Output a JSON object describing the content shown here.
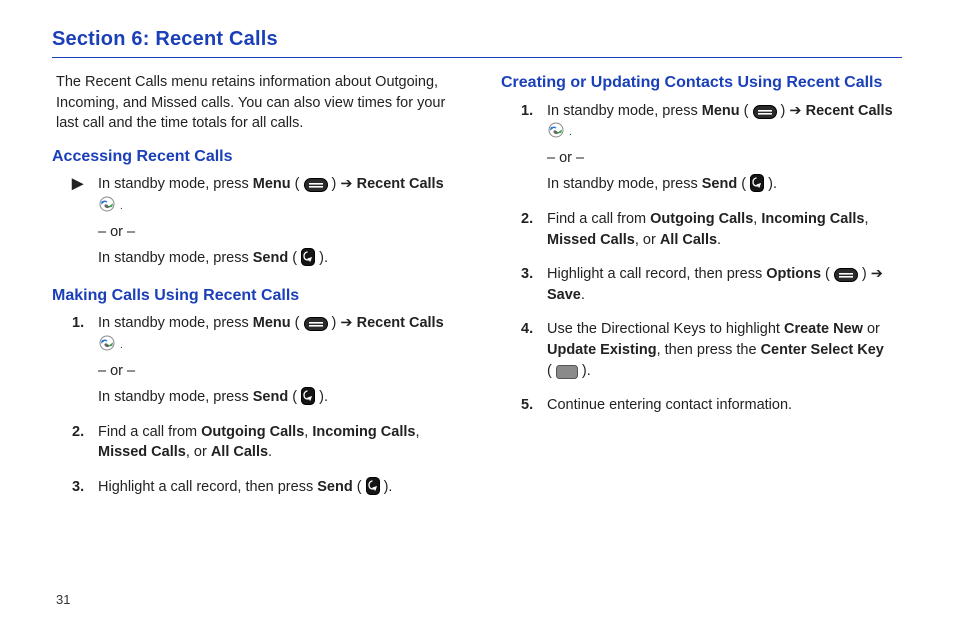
{
  "section_title": "Section 6: Recent Calls",
  "page_number": "31",
  "intro": "The Recent Calls menu retains information about Outgoing, Incoming, and Missed calls. You can also view times for your last call and the time totals for all calls.",
  "glyphs": {
    "pointer": "▶",
    "arrow_right": "➔",
    "or_sep": "– or –"
  },
  "labels": {
    "menu": "Menu",
    "send": "Send",
    "recent_calls": "Recent Calls",
    "options": "Options",
    "save": "Save",
    "center_select_key": "Center Select Key",
    "create_new": "Create New",
    "update_existing": "Update Existing",
    "outgoing_calls": "Outgoing Calls",
    "incoming_calls": "Incoming Calls",
    "missed_calls": "Missed Calls",
    "all_calls": "All Calls"
  },
  "headings": {
    "accessing": "Accessing Recent Calls",
    "making": "Making Calls Using Recent Calls",
    "creating": "Creating or Updating Contacts Using Recent Calls"
  },
  "text": {
    "in_standby_press": "In standby mode, press",
    "find_call_prefix": "Find a call from",
    "comma": ",",
    "or_word": ", or",
    "period": ".",
    "highlight_press_send": "Highlight a call record, then press",
    "highlight_press_options": "Highlight a call record, then press",
    "dir_keys_prefix": "Use the Directional Keys to highlight",
    "or_mid": "or",
    "then_press": ", then press the",
    "continue_entry": "Continue entering contact information."
  },
  "steps": {
    "making": [
      "1.",
      "2.",
      "3."
    ],
    "creating": [
      "1.",
      "2.",
      "3.",
      "4.",
      "5."
    ]
  }
}
